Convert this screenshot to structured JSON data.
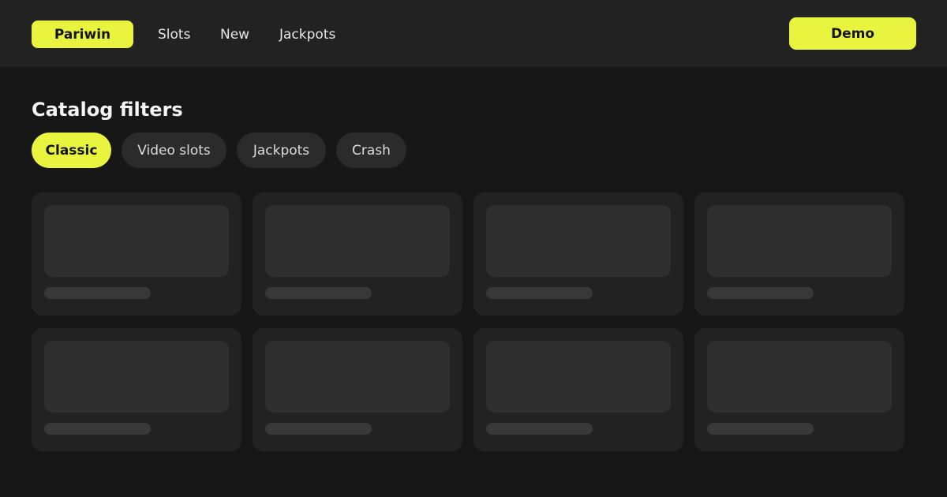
{
  "header": {
    "brand": "Pariwin",
    "nav": [
      {
        "label": "Slots"
      },
      {
        "label": "New"
      },
      {
        "label": "Jackpots"
      }
    ],
    "demo_label": "Demo"
  },
  "filters": {
    "title": "Catalog filters",
    "chips": [
      {
        "label": "Classic",
        "active": true
      },
      {
        "label": "Video slots",
        "active": false
      },
      {
        "label": "Jackpots",
        "active": false
      },
      {
        "label": "Crash",
        "active": false
      }
    ]
  },
  "colors": {
    "accent": "#e8f43e",
    "background": "#171717",
    "header": "#222222",
    "card": "#222222",
    "placeholder": "#2e2e2e"
  }
}
